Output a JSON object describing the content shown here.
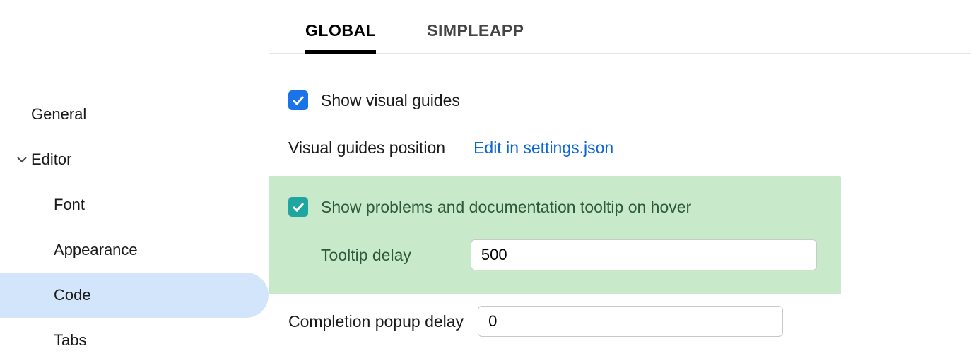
{
  "sidebar": {
    "items": [
      {
        "label": "General"
      },
      {
        "label": "Editor"
      },
      {
        "label": "Font"
      },
      {
        "label": "Appearance"
      },
      {
        "label": "Code"
      },
      {
        "label": "Tabs"
      }
    ]
  },
  "tabs": [
    {
      "label": "GLOBAL"
    },
    {
      "label": "SIMPLEAPP"
    }
  ],
  "settings": {
    "show_visual_guides_label": "Show visual guides",
    "visual_guides_position_label": "Visual guides position",
    "edit_in_settings_link": "Edit in settings.json",
    "show_tooltip_label": "Show problems and documentation tooltip on hover",
    "tooltip_delay_label": "Tooltip delay",
    "tooltip_delay_value": "500",
    "completion_popup_delay_label": "Completion popup delay",
    "completion_popup_delay_value": "0"
  }
}
